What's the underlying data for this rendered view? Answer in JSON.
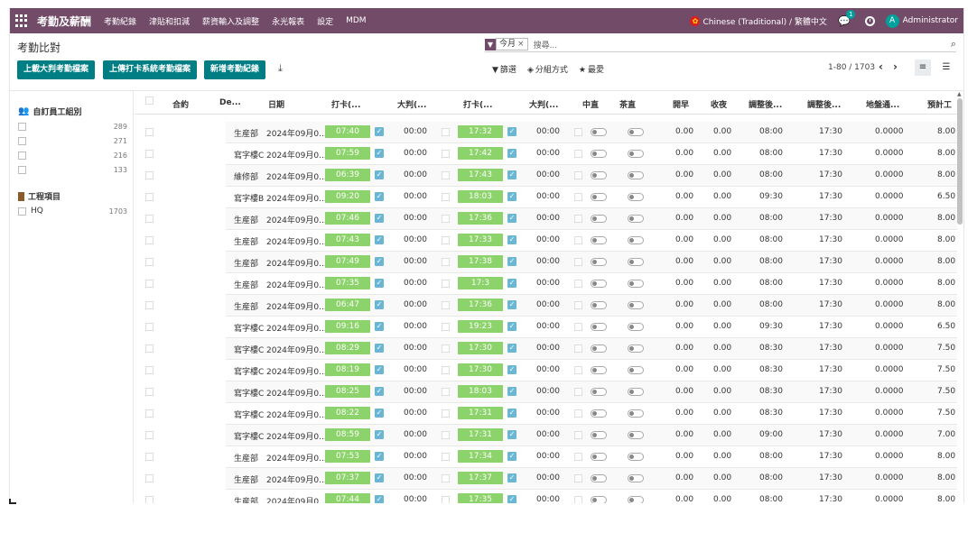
{
  "navbar": {
    "brand": "考勤及薪酬",
    "menus": [
      "考勤紀錄",
      "津貼和扣減",
      "薪資輸入及調整",
      "永光報表",
      "設定",
      "MDM"
    ],
    "language": "Chinese (Traditional) / 繁體中文",
    "chat_count": "1",
    "avatar_letter": "A",
    "user": "Administrator"
  },
  "page": {
    "title": "考勤比對",
    "buttons": [
      "上載大判考勤檔案",
      "上傳打卡系統考勤檔案",
      "新增考勤紀錄"
    ],
    "search_facet": "今月",
    "search_placeholder": "搜尋...",
    "filter_label": "篩選",
    "group_label": "分組方式",
    "favorite_label": "最愛",
    "pager": "1-80 / 1703"
  },
  "searchpanel": {
    "group1_title": "自訂員工組別",
    "group1_items": [
      {
        "label": "",
        "count": "289"
      },
      {
        "label": "",
        "count": "271"
      },
      {
        "label": "",
        "count": "216"
      },
      {
        "label": "",
        "count": "133"
      }
    ],
    "group2_title": "工程項目",
    "group2_items": [
      {
        "label": "HQ",
        "count": "1703"
      }
    ]
  },
  "columns": [
    "合約",
    "De...",
    "日期",
    "打卡(...",
    "大判(...",
    "打卡(...",
    "大判(...",
    "中直",
    "茶直",
    "開早",
    "收夜",
    "調整後...",
    "調整後...",
    "地盤通...",
    "預計工"
  ],
  "rows": [
    {
      "dept": "生産部",
      "date": "2024年09月0...",
      "in": "07:40",
      "jin": "00:00",
      "out": "17:32",
      "jout": "00:00",
      "early": "0.00",
      "late": "0.00",
      "adj_in": "08:00",
      "adj_out": "17:30",
      "site": "0.0000",
      "hours": "8.00"
    },
    {
      "dept": "寫字樓C",
      "date": "2024年09月0...",
      "in": "07:59",
      "jin": "00:00",
      "out": "17:42",
      "jout": "00:00",
      "early": "0.00",
      "late": "0.00",
      "adj_in": "08:00",
      "adj_out": "17:30",
      "site": "0.0000",
      "hours": "8.00"
    },
    {
      "dept": "維修部",
      "date": "2024年09月0...",
      "in": "06:39",
      "jin": "00:00",
      "out": "17:43",
      "jout": "00:00",
      "early": "0.00",
      "late": "0.00",
      "adj_in": "08:00",
      "adj_out": "17:30",
      "site": "0.0000",
      "hours": "8.00"
    },
    {
      "dept": "寫字樓B",
      "date": "2024年09月0...",
      "in": "09:20",
      "jin": "00:00",
      "out": "18:03",
      "jout": "00:00",
      "early": "0.00",
      "late": "0.00",
      "adj_in": "09:30",
      "adj_out": "17:30",
      "site": "0.0000",
      "hours": "6.50"
    },
    {
      "dept": "生産部",
      "date": "2024年09月0...",
      "in": "07:46",
      "jin": "00:00",
      "out": "17:36",
      "jout": "00:00",
      "early": "0.00",
      "late": "0.00",
      "adj_in": "08:00",
      "adj_out": "17:30",
      "site": "0.0000",
      "hours": "8.00"
    },
    {
      "dept": "生産部",
      "date": "2024年09月0...",
      "in": "07:43",
      "jin": "00:00",
      "out": "17:33",
      "jout": "00:00",
      "early": "0.00",
      "late": "0.00",
      "adj_in": "08:00",
      "adj_out": "17:30",
      "site": "0.0000",
      "hours": "8.00"
    },
    {
      "dept": "生産部",
      "date": "2024年09月0...",
      "in": "07:49",
      "jin": "00:00",
      "out": "17:38",
      "jout": "00:00",
      "early": "0.00",
      "late": "0.00",
      "adj_in": "08:00",
      "adj_out": "17:30",
      "site": "0.0000",
      "hours": "8.00"
    },
    {
      "dept": "生産部",
      "date": "2024年09月0...",
      "in": "07:35",
      "jin": "00:00",
      "out": "17:3",
      "jout": "00:00",
      "early": "0.00",
      "late": "0.00",
      "adj_in": "08:00",
      "adj_out": "17:30",
      "site": "0.0000",
      "hours": "8.00"
    },
    {
      "dept": "生産部",
      "date": "2024年09月0...",
      "in": "06:47",
      "jin": "00:00",
      "out": "17:36",
      "jout": "00:00",
      "early": "0.00",
      "late": "0.00",
      "adj_in": "08:00",
      "adj_out": "17:30",
      "site": "0.0000",
      "hours": "8.00"
    },
    {
      "dept": "寫字樓C",
      "date": "2024年09月0...",
      "in": "09:16",
      "jin": "00:00",
      "out": "19:23",
      "jout": "00:00",
      "early": "0.00",
      "late": "0.00",
      "adj_in": "09:30",
      "adj_out": "17:30",
      "site": "0.0000",
      "hours": "6.50"
    },
    {
      "dept": "寫字樓C",
      "date": "2024年09月0...",
      "in": "08:29",
      "jin": "00:00",
      "out": "17:30",
      "jout": "00:00",
      "early": "0.00",
      "late": "0.00",
      "adj_in": "08:30",
      "adj_out": "17:30",
      "site": "0.0000",
      "hours": "7.50"
    },
    {
      "dept": "寫字樓C",
      "date": "2024年09月0...",
      "in": "08:19",
      "jin": "00:00",
      "out": "17:30",
      "jout": "00:00",
      "early": "0.00",
      "late": "0.00",
      "adj_in": "08:30",
      "adj_out": "17:30",
      "site": "0.0000",
      "hours": "7.50"
    },
    {
      "dept": "寫字樓C",
      "date": "2024年09月0...",
      "in": "08:25",
      "jin": "00:00",
      "out": "18:03",
      "jout": "00:00",
      "early": "0.00",
      "late": "0.00",
      "adj_in": "08:30",
      "adj_out": "17:30",
      "site": "0.0000",
      "hours": "7.50"
    },
    {
      "dept": "寫字樓C",
      "date": "2024年09月0...",
      "in": "08:22",
      "jin": "00:00",
      "out": "17:31",
      "jout": "00:00",
      "early": "0.00",
      "late": "0.00",
      "adj_in": "08:30",
      "adj_out": "17:30",
      "site": "0.0000",
      "hours": "7.50"
    },
    {
      "dept": "寫字樓C",
      "date": "2024年09月0...",
      "in": "08:59",
      "jin": "00:00",
      "out": "17:31",
      "jout": "00:00",
      "early": "0.00",
      "late": "0.00",
      "adj_in": "09:00",
      "adj_out": "17:30",
      "site": "0.0000",
      "hours": "7.00"
    },
    {
      "dept": "生産部",
      "date": "2024年09月0...",
      "in": "07:53",
      "jin": "00:00",
      "out": "17:34",
      "jout": "00:00",
      "early": "0.00",
      "late": "0.00",
      "adj_in": "08:00",
      "adj_out": "17:30",
      "site": "0.0000",
      "hours": "8.00"
    },
    {
      "dept": "生産部",
      "date": "2024年09月0...",
      "in": "07:37",
      "jin": "00:00",
      "out": "17:37",
      "jout": "00:00",
      "early": "0.00",
      "late": "0.00",
      "adj_in": "08:00",
      "adj_out": "17:30",
      "site": "0.0000",
      "hours": "8.00"
    },
    {
      "dept": "生産部",
      "date": "2024年09月0...",
      "in": "07:44",
      "jin": "00:00",
      "out": "17:35",
      "jout": "00:00",
      "early": "0.00",
      "late": "0.00",
      "adj_in": "08:00",
      "adj_out": "17:30",
      "site": "0.0000",
      "hours": "8.00"
    }
  ],
  "colors": {
    "navbar": "#714b67",
    "primary_button": "#017e84",
    "time_ok": "#8bd36a",
    "tick": "#6ab7d4"
  }
}
